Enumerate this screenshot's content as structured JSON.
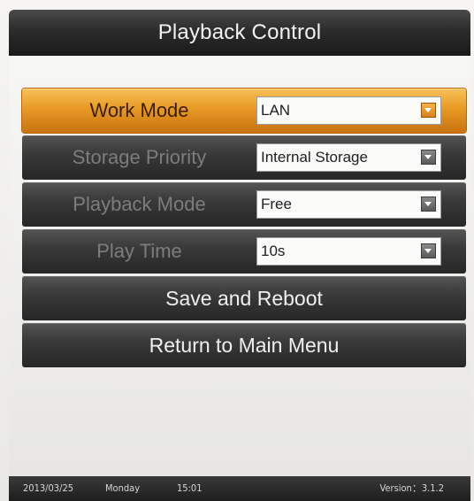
{
  "title": "Playback Control",
  "settings": [
    {
      "label": "Work Mode",
      "value": "LAN",
      "selected": true
    },
    {
      "label": "Storage Priority",
      "value": "Internal Storage",
      "selected": false
    },
    {
      "label": "Playback Mode",
      "value": "Free",
      "selected": false
    },
    {
      "label": "Play Time",
      "value": "10s",
      "selected": false
    }
  ],
  "actions": {
    "save_reboot": "Save and Reboot",
    "return_main": "Return to Main Menu"
  },
  "status": {
    "date": "2013/03/25",
    "day": "Monday",
    "time": "15:01",
    "version": "Version：3.1.2"
  },
  "colors": {
    "accent": "#e89a24",
    "titlebar": "#2c2c2c",
    "row_bg": "#3a3a3a"
  },
  "icons": {
    "dropdown": "chevron-down-icon"
  }
}
